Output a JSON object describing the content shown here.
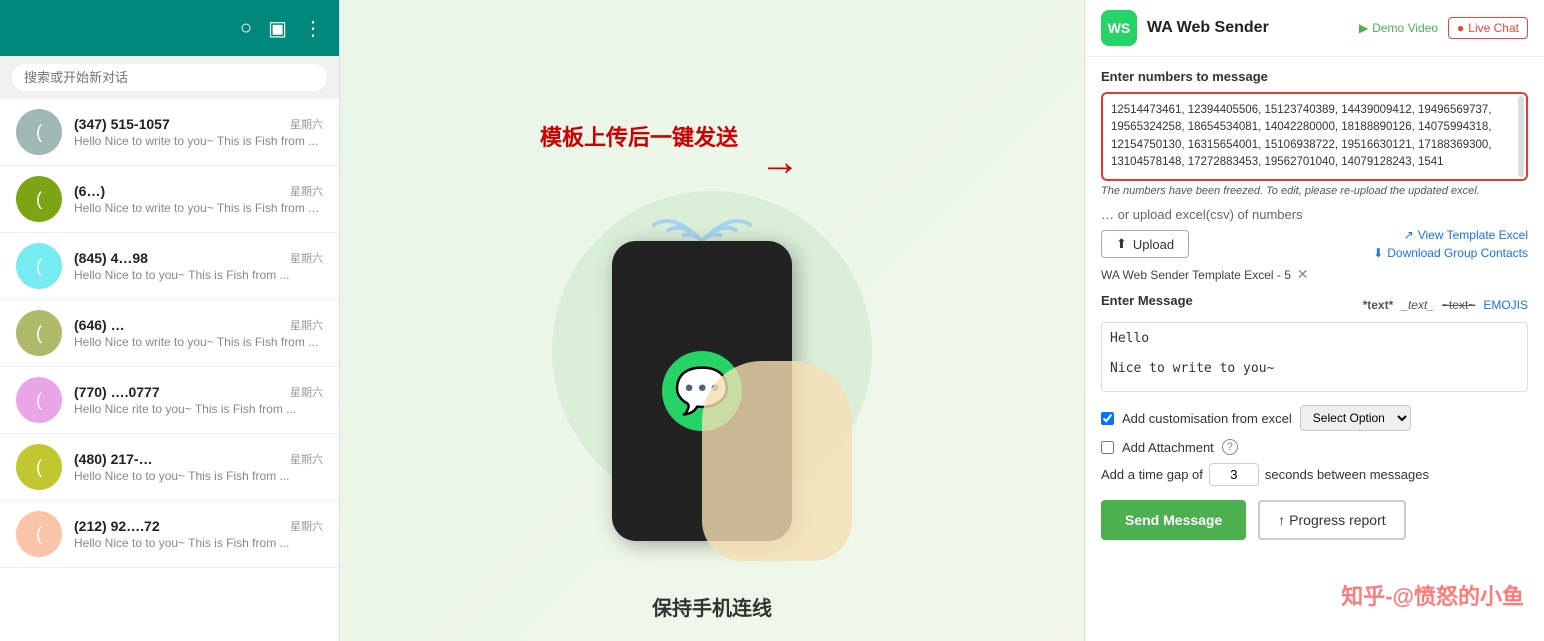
{
  "app": {
    "title": "WA Web Sender"
  },
  "left_panel": {
    "header_icons": [
      "refresh",
      "chat",
      "menu"
    ],
    "search_placeholder": "搜索或开始新对话",
    "chats": [
      {
        "id": 1,
        "name": "(347) 515-1057",
        "time": "星期六",
        "preview": "Hello  Nice to write to you~ This is Fish from ..."
      },
      {
        "id": 2,
        "name": "(6…)",
        "time": "星期六",
        "preview": "Hello Nice to write to you~ This is Fish from A..."
      },
      {
        "id": 3,
        "name": "(845) 4…98",
        "time": "星期六",
        "preview": "Hello Nice to  to you~ This is Fish from ..."
      },
      {
        "id": 4,
        "name": "(646) …",
        "time": "星期六",
        "preview": "Hello Nice to write to you~ This is Fish from ..."
      },
      {
        "id": 5,
        "name": "(770) ….0777",
        "time": "星期六",
        "preview": "Hello  Nice  rite to you~ This is Fish from ..."
      },
      {
        "id": 6,
        "name": "(480) 217-…",
        "time": "星期六",
        "preview": "Hello Nice to  to you~ This is Fish from ..."
      },
      {
        "id": 7,
        "name": "(212) 92….72",
        "time": "星期六",
        "preview": "Hello Nice to  to you~ This is Fish from ..."
      }
    ]
  },
  "promo": {
    "text": "模板上传后一键发送",
    "bottom_text": "保持手机连线"
  },
  "right_panel": {
    "logo_text": "WS",
    "title": "WA Web Sender",
    "demo_video_label": "Demo Video",
    "live_chat_label": "Live Chat",
    "numbers_section_label": "Enter numbers to message",
    "numbers_content": "12514473461, 12394405506, 15123740389, 14439009412, 19496569737, 19565324258, 18654534081, 14042280000, 18188890126, 14075994318, 12154750130, 16315654001, 15106938722, 19516630121, 17188369300, 13104578148, 17272883453, 19562701040, 14079128243, 1541",
    "freeze_notice": "The numbers have been freezed. To edit, please re-upload the updated excel.",
    "upload_section_label": "… or upload excel(csv) of numbers",
    "upload_button_label": "Upload",
    "view_template_label": "View Template Excel",
    "download_group_label": "Download Group Contacts",
    "file_tag": "WA Web Sender Template Excel - 5",
    "message_section_label": "Enter Message",
    "format_bold": "*text*",
    "format_italic": "_text_",
    "format_strike": "~text~",
    "format_emoji": "EMOJIS",
    "message_content": "Hello\n\nNice to write to you~",
    "customisation_label": "Add customisation from excel",
    "customisation_checked": true,
    "select_option_label": "Select Option",
    "attachment_label": "Add Attachment",
    "attachment_checked": false,
    "time_gap_label_before": "Add a time gap of",
    "time_gap_value": "3",
    "time_gap_label_after": "seconds between messages",
    "send_button_label": "Send Message",
    "progress_report_label": "↑ Progress report"
  },
  "watermark": "知乎-@愤怒的小鱼"
}
